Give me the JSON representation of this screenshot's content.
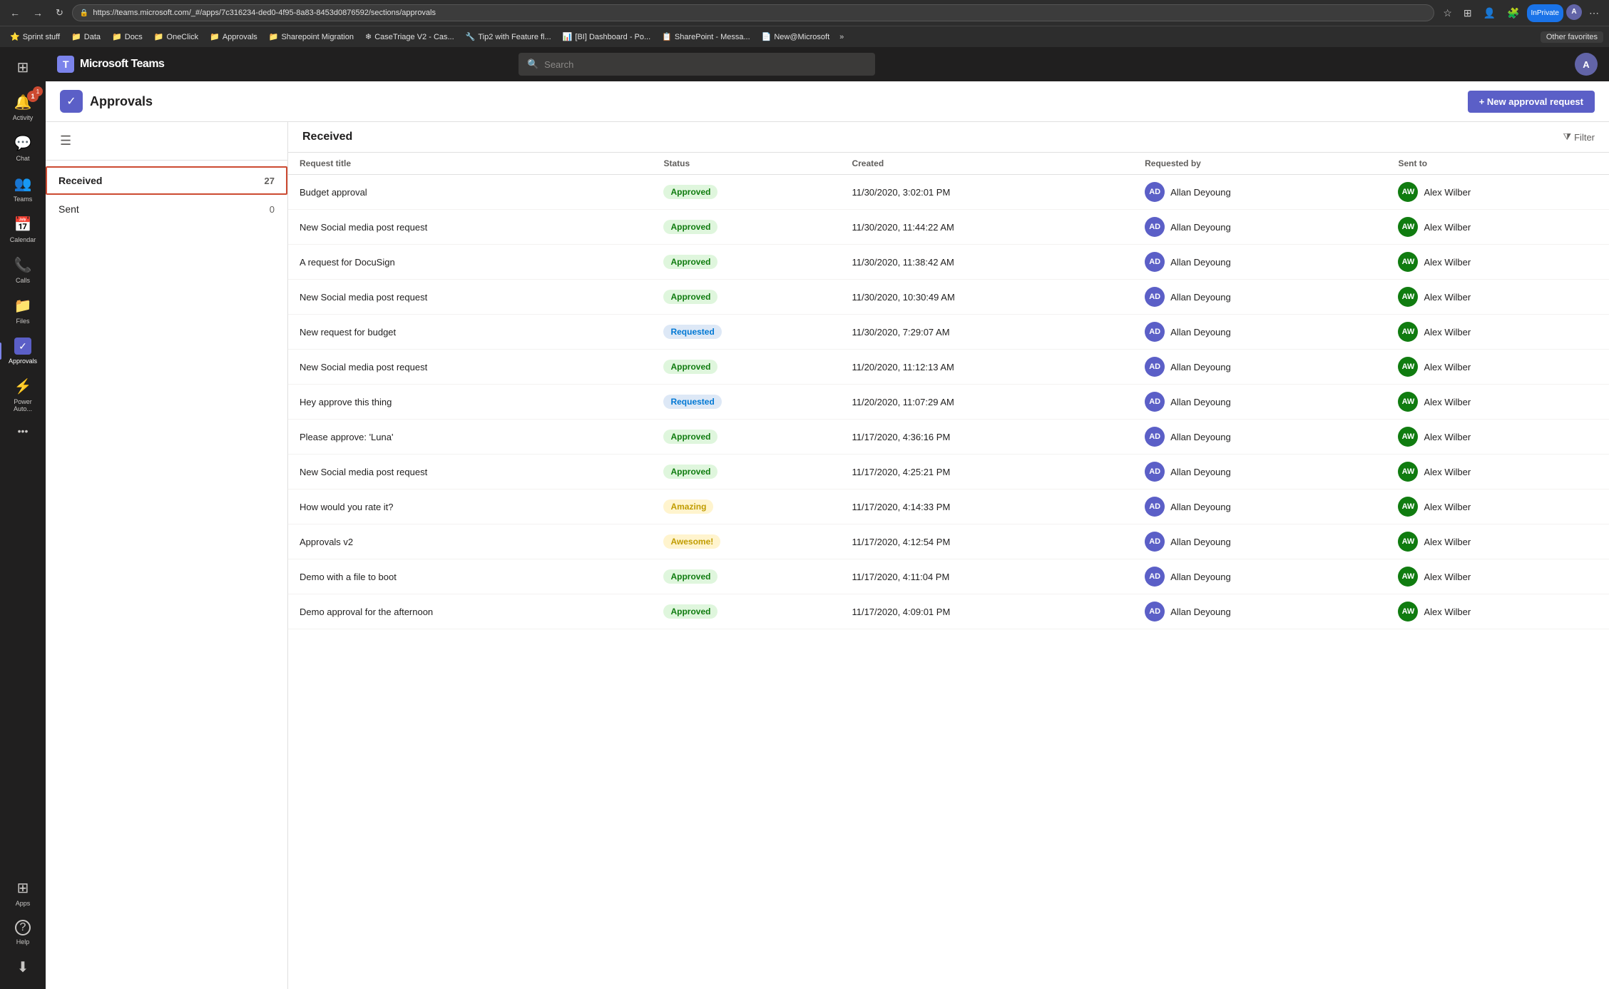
{
  "browser": {
    "url": "https://teams.microsoft.com/_#/apps/7c316234-ded0-4f95-8a83-8453d0876592/sections/approvals",
    "back_btn": "←",
    "forward_btn": "→",
    "refresh_btn": "↻",
    "other_favorites": "Other favorites",
    "bookmarks": [
      {
        "id": "sprint",
        "label": "Sprint stuff",
        "icon": "⭐"
      },
      {
        "id": "data",
        "label": "Data",
        "icon": "📁"
      },
      {
        "id": "docs",
        "label": "Docs",
        "icon": "📁"
      },
      {
        "id": "oneclick",
        "label": "OneClick",
        "icon": "📁"
      },
      {
        "id": "approvals",
        "label": "Approvals",
        "icon": "📁"
      },
      {
        "id": "sharepoint",
        "label": "Sharepoint Migration",
        "icon": "📁"
      },
      {
        "id": "casetriage",
        "label": "CaseTriage V2 - Cas...",
        "icon": "❄"
      },
      {
        "id": "tip2",
        "label": "Tip2 with Feature fl...",
        "icon": "🔧"
      },
      {
        "id": "bi",
        "label": "[BI] Dashboard - Po...",
        "icon": "📊"
      },
      {
        "id": "spMessage",
        "label": "SharePoint - Messa...",
        "icon": "📋"
      },
      {
        "id": "newMs",
        "label": "New@Microsoft",
        "icon": "📄"
      }
    ]
  },
  "teams_header": {
    "logo_text": "Microsoft Teams",
    "search_placeholder": "Search",
    "overflow_btn": "⋯"
  },
  "sidebar": {
    "items": [
      {
        "id": "activity",
        "label": "Activity",
        "icon": "🔔",
        "badge": "1"
      },
      {
        "id": "chat",
        "label": "Chat",
        "icon": "💬"
      },
      {
        "id": "teams",
        "label": "Teams",
        "icon": "👥"
      },
      {
        "id": "calendar",
        "label": "Calendar",
        "icon": "📅"
      },
      {
        "id": "calls",
        "label": "Calls",
        "icon": "📞"
      },
      {
        "id": "files",
        "label": "Files",
        "icon": "📁"
      },
      {
        "id": "approvals",
        "label": "Approvals",
        "icon": "✓",
        "active": true
      },
      {
        "id": "power-automate",
        "label": "Power Auto...",
        "icon": "⚡"
      }
    ],
    "bottom_items": [
      {
        "id": "apps",
        "label": "Apps",
        "icon": "⊞"
      },
      {
        "id": "help",
        "label": "Help",
        "icon": "?"
      },
      {
        "id": "download",
        "label": "Download",
        "icon": "⬇"
      }
    ],
    "more_btn": "•••"
  },
  "approvals_page": {
    "icon": "✓",
    "title": "Approvals",
    "new_btn": "+ New approval request",
    "menu_icon": "☰",
    "filter_btn": "Filter",
    "nav": [
      {
        "id": "received",
        "label": "Received",
        "count": "27",
        "active": true
      },
      {
        "id": "sent",
        "label": "Sent",
        "count": "0",
        "active": false
      }
    ],
    "table": {
      "section_title": "Received",
      "columns": [
        "Request title",
        "Status",
        "Created",
        "Requested by",
        "Sent to"
      ],
      "rows": [
        {
          "title": "Budget approval",
          "status": "Approved",
          "status_type": "approved",
          "created": "11/30/2020, 3:02:01 PM",
          "requested_by": "Allan Deyoung",
          "sent_to": "Alex Wilber"
        },
        {
          "title": "New Social media post request",
          "status": "Approved",
          "status_type": "approved",
          "created": "11/30/2020, 11:44:22 AM",
          "requested_by": "Allan Deyoung",
          "sent_to": "Alex Wilber"
        },
        {
          "title": "A request for DocuSign",
          "status": "Approved",
          "status_type": "approved",
          "created": "11/30/2020, 11:38:42 AM",
          "requested_by": "Allan Deyoung",
          "sent_to": "Alex Wilber"
        },
        {
          "title": "New Social media post request",
          "status": "Approved",
          "status_type": "approved",
          "created": "11/30/2020, 10:30:49 AM",
          "requested_by": "Allan Deyoung",
          "sent_to": "Alex Wilber"
        },
        {
          "title": "New request for budget",
          "status": "Requested",
          "status_type": "requested",
          "created": "11/30/2020, 7:29:07 AM",
          "requested_by": "Allan Deyoung",
          "sent_to": "Alex Wilber"
        },
        {
          "title": "New Social media post request",
          "status": "Approved",
          "status_type": "approved",
          "created": "11/20/2020, 11:12:13 AM",
          "requested_by": "Allan Deyoung",
          "sent_to": "Alex Wilber"
        },
        {
          "title": "Hey approve this thing",
          "status": "Requested",
          "status_type": "requested",
          "created": "11/20/2020, 11:07:29 AM",
          "requested_by": "Allan Deyoung",
          "sent_to": "Alex Wilber"
        },
        {
          "title": "Please approve: 'Luna'",
          "status": "Approved",
          "status_type": "approved",
          "created": "11/17/2020, 4:36:16 PM",
          "requested_by": "Allan Deyoung",
          "sent_to": "Alex Wilber"
        },
        {
          "title": "New Social media post request",
          "status": "Approved",
          "status_type": "approved",
          "created": "11/17/2020, 4:25:21 PM",
          "requested_by": "Allan Deyoung",
          "sent_to": "Alex Wilber"
        },
        {
          "title": "How would you rate it?",
          "status": "Amazing",
          "status_type": "amazing",
          "created": "11/17/2020, 4:14:33 PM",
          "requested_by": "Allan Deyoung",
          "sent_to": "Alex Wilber"
        },
        {
          "title": "Approvals v2",
          "status": "Awesome!",
          "status_type": "awesome",
          "created": "11/17/2020, 4:12:54 PM",
          "requested_by": "Allan Deyoung",
          "sent_to": "Alex Wilber"
        },
        {
          "title": "Demo with a file to boot",
          "status": "Approved",
          "status_type": "approved",
          "created": "11/17/2020, 4:11:04 PM",
          "requested_by": "Allan Deyoung",
          "sent_to": "Alex Wilber"
        },
        {
          "title": "Demo approval for the afternoon",
          "status": "Approved",
          "status_type": "approved",
          "created": "11/17/2020, 4:09:01 PM",
          "requested_by": "Allan Deyoung",
          "sent_to": "Alex Wilber"
        }
      ]
    }
  }
}
